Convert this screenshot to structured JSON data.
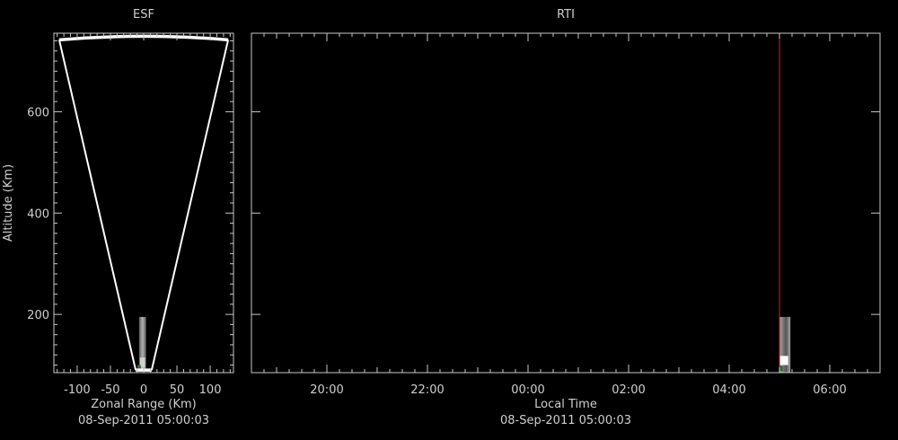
{
  "colors": {
    "background": "#000000",
    "axis": "#c8c8c8",
    "text": "#cfcfcf",
    "beam": "#ffffff",
    "current_time_marker": "#b02020",
    "echo_light": "#d0d0d0",
    "echo_dark": "#6a6a6a",
    "echo_green": "#2f6b3a"
  },
  "chart_data": [
    {
      "type": "heatmap",
      "title": "ESF",
      "xlabel": "Zonal Range (Km)",
      "ylabel": "Altitude (Km)",
      "subtitle": "08-Sep-2011 05:00:03",
      "xlim": [
        -135,
        135
      ],
      "ylim": [
        85,
        755
      ],
      "x_ticks": [
        -100,
        -50,
        0,
        50,
        100
      ],
      "x_tick_labels": [
        "-100",
        "-50",
        "0",
        "50",
        "100"
      ],
      "y_ticks": [
        200,
        400,
        600
      ],
      "y_tick_labels": [
        "200",
        "400",
        "600"
      ],
      "beam_sector": {
        "origin_altitude": 90,
        "half_width_at_base": 12,
        "left_edge_top": [
          -127,
          742
        ],
        "right_edge_top": [
          127,
          742
        ],
        "arc_peak_altitude": 749
      },
      "echo_region": {
        "x_range": [
          -11,
          5
        ],
        "altitude_range": [
          88,
          195
        ]
      }
    },
    {
      "type": "heatmap",
      "title": "RTI",
      "xlabel": "Local Time",
      "ylabel": "",
      "subtitle": "08-Sep-2011 05:00:03",
      "xlim": [
        "2011-09-07T18:30",
        "2011-09-08T07:00"
      ],
      "ylim": [
        85,
        755
      ],
      "x_ticks": [
        "2011-09-07T20:00",
        "2011-09-07T22:00",
        "2011-09-08T00:00",
        "2011-09-08T02:00",
        "2011-09-08T04:00",
        "2011-09-08T06:00"
      ],
      "x_tick_labels": [
        "20:00",
        "22:00",
        "00:00",
        "02:00",
        "04:00",
        "06:00"
      ],
      "y_ticks": [
        200,
        400,
        600
      ],
      "current_time": "2011-09-08T05:00",
      "echo_region": {
        "time_range": [
          "2011-09-08T05:00",
          "2011-09-08T05:13"
        ],
        "altitude_range": [
          85,
          195
        ]
      }
    }
  ]
}
